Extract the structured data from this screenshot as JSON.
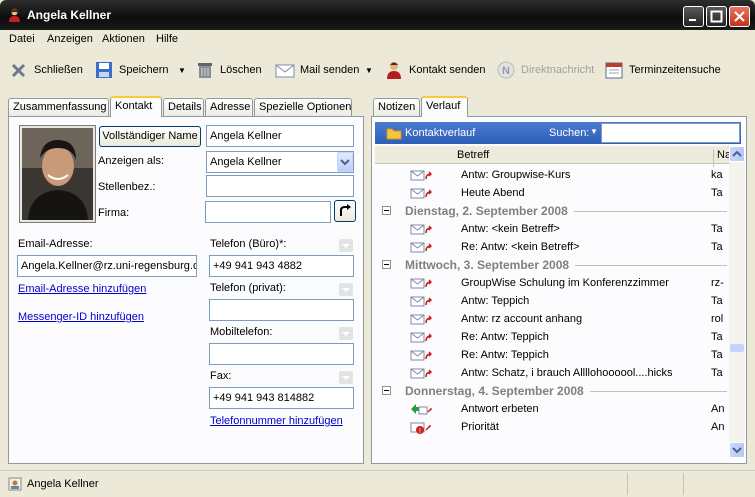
{
  "window": {
    "title": "Angela Kellner"
  },
  "menu": [
    {
      "label": "Datei"
    },
    {
      "label": "Anzeigen"
    },
    {
      "label": "Aktionen"
    },
    {
      "label": "Hilfe"
    }
  ],
  "toolbar": {
    "close": "Schließen",
    "save": "Speichern",
    "delete": "Löschen",
    "mail": "Mail senden",
    "contact": "Kontakt senden",
    "direct": "Direktnachricht",
    "schedule": "Terminzeitensuche"
  },
  "left_tabs": [
    "Zusammenfassung",
    "Kontakt",
    "Details",
    "Adresse",
    "Spezielle Optionen"
  ],
  "contact": {
    "fullname_button": "Vollständiger Name",
    "fullname_value": "Angela Kellner",
    "display_as_label": "Anzeigen als:",
    "display_as_value": "Angela Kellner",
    "position_label": "Stellenbez.:",
    "position_value": "",
    "company_label": "Firma:",
    "company_value": "",
    "email_label": "Email-Adresse:",
    "email_value": "Angela.Kellner@rz.uni-regensburg.d",
    "add_email": "Email-Adresse hinzufügen",
    "add_messenger": "Messenger-ID hinzufügen",
    "phone_office_label": "Telefon (Büro)*:",
    "phone_office_value": "+49 941 943 4882",
    "phone_private_label": "Telefon (privat):",
    "phone_private_value": "",
    "mobile_label": "Mobiltelefon:",
    "mobile_value": "",
    "fax_label": "Fax:",
    "fax_value": "+49 941 943 814882",
    "add_phone": "Telefonnummer hinzufügen"
  },
  "right_tabs": [
    "Notizen",
    "Verlauf"
  ],
  "history": {
    "header": "Kontaktverlauf",
    "search_label": "Suchen:",
    "search_value": "",
    "col_subject": "Betreff",
    "col_name": "Na",
    "rows": [
      {
        "kind": "item",
        "icon": "mail-reply-icon",
        "subject": "Antw: Groupwise-Kurs",
        "name": "ka"
      },
      {
        "kind": "item",
        "icon": "mail-reply-icon",
        "subject": "Heute Abend",
        "name": "Ta"
      },
      {
        "kind": "group",
        "label": "Dienstag, 2. September 2008"
      },
      {
        "kind": "item",
        "icon": "mail-reply-icon",
        "subject": "Antw: <kein Betreff>",
        "name": "Ta"
      },
      {
        "kind": "item",
        "icon": "mail-reply-icon",
        "subject": "Re: Antw: <kein Betreff>",
        "name": "Ta"
      },
      {
        "kind": "group",
        "label": "Mittwoch, 3. September 2008"
      },
      {
        "kind": "item",
        "icon": "mail-reply-icon",
        "subject": "GroupWise Schulung im Konferenzzimmer",
        "name": "rz-"
      },
      {
        "kind": "item",
        "icon": "mail-reply-icon",
        "subject": "Antw: Teppich",
        "name": "Ta"
      },
      {
        "kind": "item",
        "icon": "mail-reply-icon",
        "subject": "Antw: rz account anhang",
        "name": "rol"
      },
      {
        "kind": "item",
        "icon": "mail-reply-icon",
        "subject": "Re: Antw: Teppich",
        "name": "Ta"
      },
      {
        "kind": "item",
        "icon": "mail-reply-icon",
        "subject": "Re: Antw: Teppich",
        "name": "Ta"
      },
      {
        "kind": "item",
        "icon": "mail-reply-icon",
        "subject": "Antw: Schatz, i brauch Allllohoooool....hicks",
        "name": "Ta"
      },
      {
        "kind": "group",
        "label": "Donnerstag, 4. September 2008"
      },
      {
        "kind": "item",
        "icon": "reply-requested-icon",
        "subject": "Antwort erbeten",
        "name": "An"
      },
      {
        "kind": "item",
        "icon": "priority-icon",
        "subject": "Priorität",
        "name": "An"
      }
    ]
  },
  "status": {
    "text": "Angela Kellner"
  }
}
